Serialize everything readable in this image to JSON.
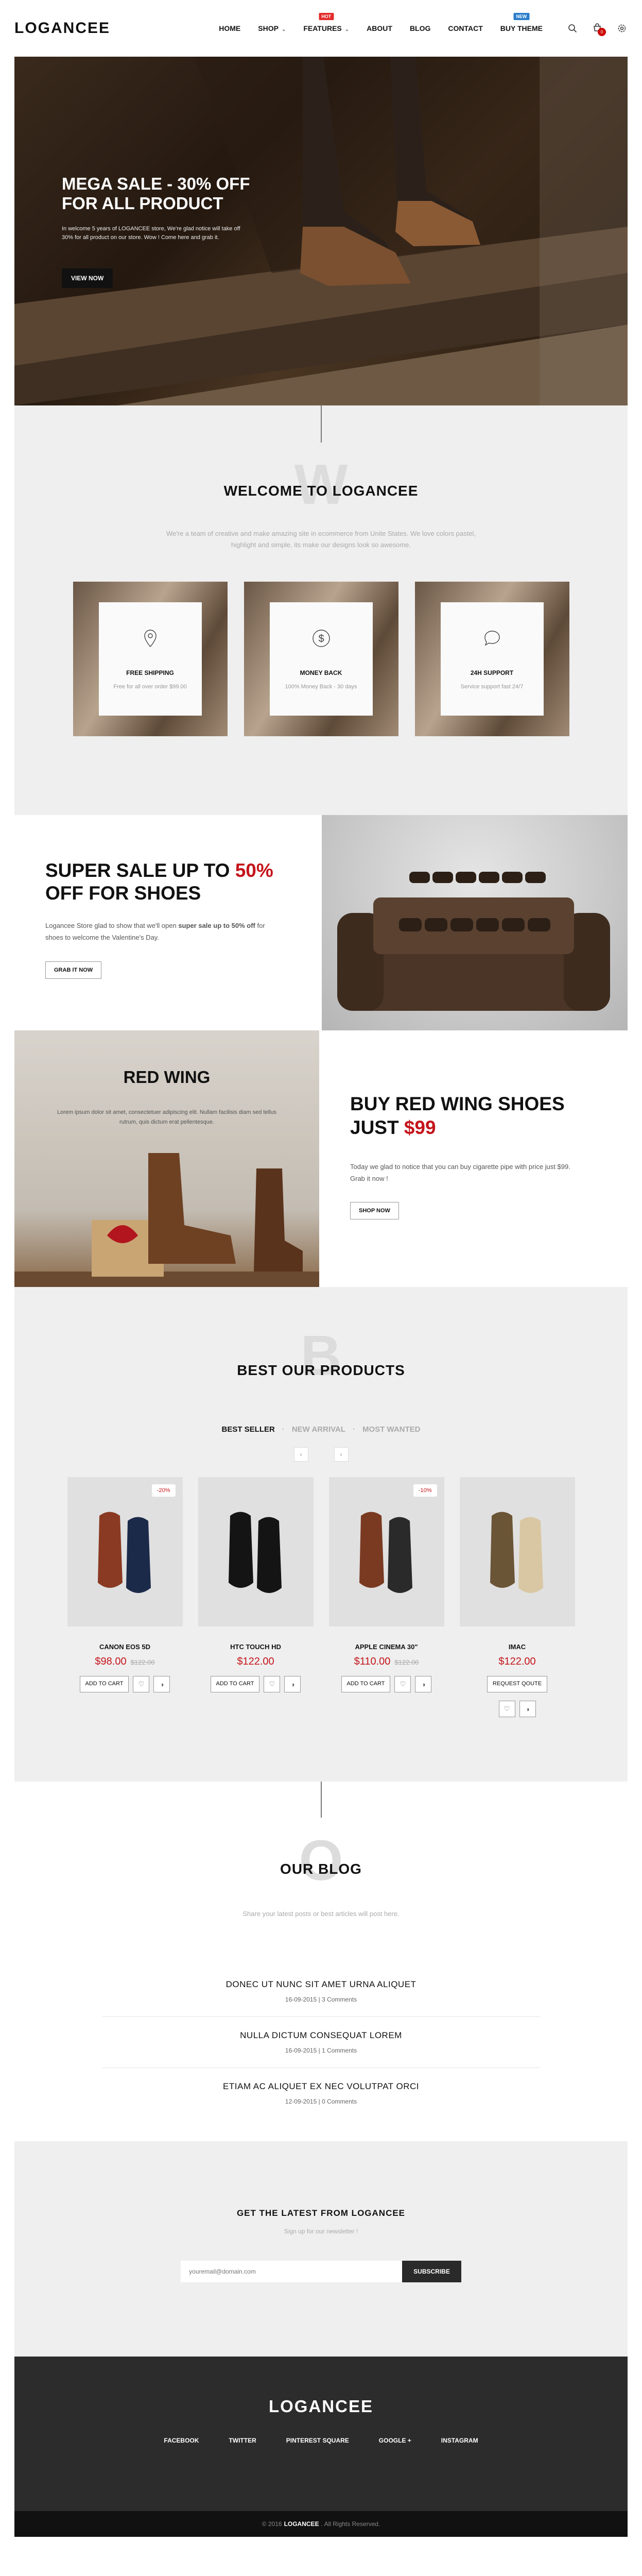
{
  "header": {
    "logo": "LOGANCEE",
    "nav": [
      {
        "label": "HOME",
        "caret": false,
        "badge": ""
      },
      {
        "label": "SHOP",
        "caret": true,
        "badge": ""
      },
      {
        "label": "FEATURES",
        "caret": true,
        "badge": "HOT"
      },
      {
        "label": "ABOUT",
        "caret": false,
        "badge": ""
      },
      {
        "label": "BLOG",
        "caret": false,
        "badge": ""
      },
      {
        "label": "CONTACT",
        "caret": false,
        "badge": ""
      },
      {
        "label": "BUY THEME",
        "caret": false,
        "badge": "NEW"
      }
    ],
    "cart_count": "0"
  },
  "hero": {
    "title_line1": "MEGA SALE - 30% OFF",
    "title_line2": "FOR ALL PRODUCT",
    "subtitle": "In welcome 5 years of LOGANCEE store, We're glad notice will take off 30% for all product on our store. Wow ! Come here and grab it.",
    "button": "VIEW NOW"
  },
  "welcome": {
    "bigletter": "W",
    "title": "WELCOME TO LOGANCEE",
    "desc": "We're a team of creative and make amazing site in ecommerce from Unite States. We love colors pastel, highlight and simple, its make our designs look so awesome.",
    "features": [
      {
        "icon": "map-pin-icon",
        "title": "FREE SHIPPING",
        "desc": "Free for all over order $99.00"
      },
      {
        "icon": "dollar-icon",
        "title": "MONEY BACK",
        "desc": "100% Money Back - 30 days"
      },
      {
        "icon": "chat-icon",
        "title": "24H SUPPORT",
        "desc": "Service support fast 24/7"
      }
    ]
  },
  "sale": {
    "title_a": "SUPER SALE UP TO ",
    "title_pct": "50%",
    "title_b": "OFF FOR SHOES",
    "desc_a": "Logancee Store glad to show that we'll open ",
    "desc_bold": "super sale up to 50% off",
    "desc_b": " for shoes to welcome the Valentine's Day.",
    "button": "GRAB IT NOW"
  },
  "redwing": {
    "brand": "RED WING",
    "brand_text": "Lorem ipsum dolor sit amet, consectetuer adipiscing elit. Nullam facilisis diam sed tellus rutrum, quis dictum erat pellentesque.",
    "title_a": "BUY RED WING SHOES",
    "title_b": "JUST ",
    "price": "$99",
    "desc": "Today we glad to notice that you can buy cigarette pipe with price just $99. Grab it now !",
    "button": "SHOP NOW"
  },
  "products": {
    "bigletter": "B",
    "title": "BEST OUR PRODUCTS",
    "tabs": [
      "BEST SELLER",
      "NEW ARRIVAL",
      "MOST WANTED"
    ],
    "items": [
      {
        "name": "CANON EOS 5D",
        "price": "$98.00",
        "old": "$122.00",
        "badge": "-20%",
        "action": "ADD TO CART",
        "color": "#8a3a22"
      },
      {
        "name": "HTC TOUCH HD",
        "price": "$122.00",
        "old": "",
        "badge": "",
        "action": "ADD TO CART",
        "color": "#141414"
      },
      {
        "name": "APPLE CINEMA 30\"",
        "price": "$110.00",
        "old": "$122.00",
        "badge": "-10%",
        "action": "ADD TO CART",
        "color": "#7a3a22"
      },
      {
        "name": "IMAC",
        "price": "$122.00",
        "old": "",
        "badge": "",
        "action": "REQUEST QOUTE",
        "color": "#6b5537"
      }
    ]
  },
  "blog": {
    "bigletter": "O",
    "title": "OUR BLOG",
    "desc": "Share your latest posts or best articles will post here.",
    "posts": [
      {
        "title": "DONEC UT NUNC SIT AMET URNA ALIQUET",
        "date": "16-09-2015",
        "comments": "3 Comments"
      },
      {
        "title": "NULLA DICTUM CONSEQUAT LOREM",
        "date": "16-09-2015",
        "comments": "1 Comments"
      },
      {
        "title": "ETIAM AC ALIQUET EX NEC VOLUTPAT ORCI",
        "date": "12-09-2015",
        "comments": "0 Comments"
      }
    ]
  },
  "newsletter": {
    "title": "GET THE LATEST FROM LOGANCEE",
    "sub": "Sign up for our newsletter !",
    "placeholder": "youremail@domain.com",
    "button": "SUBSCRIBE"
  },
  "footer": {
    "logo": "LOGANCEE",
    "links": [
      "FACEBOOK",
      "TWITTER",
      "PINTEREST SQUARE",
      "GOOGLE +",
      "INSTAGRAM"
    ],
    "copy_a": "© 2016",
    "copy_brand": "LOGANCEE",
    "copy_b": ". All Rights Reserved."
  }
}
